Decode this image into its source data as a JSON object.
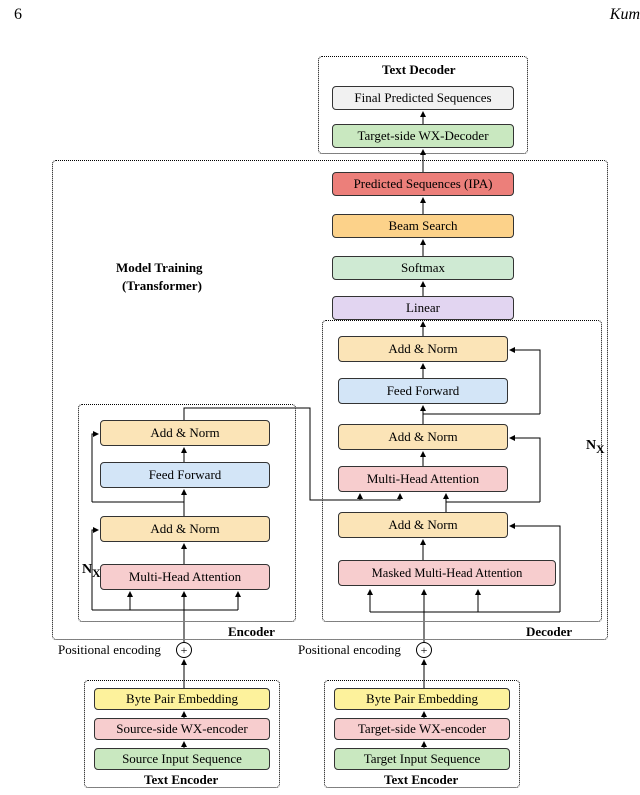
{
  "page_number": "6",
  "header_right": "Kum",
  "labels": {
    "text_decoder": "Text Decoder",
    "model_training": "Model Training",
    "transformer": "(Transformer)",
    "encoder": "Encoder",
    "decoder": "Decoder",
    "text_encoder_left": "Text Encoder",
    "text_encoder_right": "Text Encoder",
    "pos_enc_left": "Positional encoding",
    "pos_enc_right": "Positional encoding",
    "nx_left": "N",
    "nx_left_sub": "X",
    "nx_right": "N",
    "nx_right_sub": "X"
  },
  "boxes": {
    "final_pred": "Final Predicted Sequences",
    "target_wx_decoder": "Target-side WX-Decoder",
    "pred_ipa": "Predicted Sequences (IPA)",
    "beam_search": "Beam Search",
    "softmax": "Softmax",
    "linear": "Linear",
    "dec_add3": "Add & Norm",
    "dec_ff": "Feed Forward",
    "dec_add2": "Add & Norm",
    "dec_mha": "Multi-Head Attention",
    "dec_add1": "Add & Norm",
    "dec_masked": "Masked Multi-Head Attention",
    "enc_add2": "Add & Norm",
    "enc_ff": "Feed Forward",
    "enc_add1": "Add & Norm",
    "enc_mha": "Multi-Head Attention",
    "bpe_left": "Byte Pair Embedding",
    "src_wx_enc": "Source-side WX-encoder",
    "src_input": "Source Input Sequence",
    "bpe_right": "Byte Pair Embedding",
    "tgt_wx_enc": "Target-side WX-encoder",
    "tgt_input": "Target Input Sequence"
  },
  "colors": {
    "green": "#c9e8c0",
    "pink": "#f7cdce",
    "yellow": "#fdf29c",
    "tan": "#fbe4b7",
    "blue": "#d3e5f7",
    "purple": "#e2d5f1",
    "mint": "#cfead3",
    "orange": "#fcd28a",
    "red": "#ec7f7a",
    "gray": "#f1f1f1"
  }
}
